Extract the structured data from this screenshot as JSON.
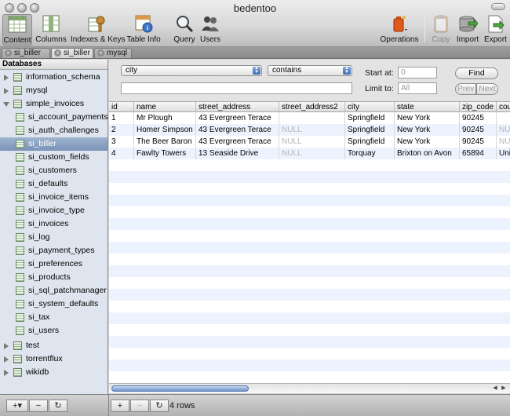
{
  "window": {
    "title": "bedentoo"
  },
  "toolbar": {
    "content": "Content",
    "columns": "Columns",
    "indexes": "Indexes & Keys",
    "table_info": "Table Info",
    "query": "Query",
    "users": "Users",
    "operations": "Operations",
    "copy": "Copy",
    "import": "Import",
    "export": "Export"
  },
  "tabs": [
    "si_biller",
    "si_biller",
    "mysql"
  ],
  "sidebar": {
    "header": "Databases",
    "items": [
      {
        "label": "information_schema"
      },
      {
        "label": "mysql"
      },
      {
        "label": "simple_invoices"
      },
      {
        "label": "si_account_payments"
      },
      {
        "label": "si_auth_challenges"
      },
      {
        "label": "si_biller"
      },
      {
        "label": "si_custom_fields"
      },
      {
        "label": "si_customers"
      },
      {
        "label": "si_defaults"
      },
      {
        "label": "si_invoice_items"
      },
      {
        "label": "si_invoice_type"
      },
      {
        "label": "si_invoices"
      },
      {
        "label": "si_log"
      },
      {
        "label": "si_payment_types"
      },
      {
        "label": "si_preferences"
      },
      {
        "label": "si_products"
      },
      {
        "label": "si_sql_patchmanager"
      },
      {
        "label": "si_system_defaults"
      },
      {
        "label": "si_tax"
      },
      {
        "label": "si_users"
      },
      {
        "label": "test"
      },
      {
        "label": "torrentflux"
      },
      {
        "label": "wikidb"
      }
    ]
  },
  "filter": {
    "field": "city",
    "operator": "contains",
    "value": "",
    "start_label": "Start at:",
    "start_placeholder": "0",
    "limit_label": "Limit to:",
    "limit_placeholder": "All",
    "find": "Find",
    "prev": "Prev",
    "next": "Next"
  },
  "grid": {
    "columns": [
      "id",
      "name",
      "street_address",
      "street_address2",
      "city",
      "state",
      "zip_code",
      "cou"
    ],
    "rows": [
      [
        "1",
        "Mr Plough",
        "43 Evergreen Terace",
        "",
        "Springfield",
        "New York",
        "90245",
        ""
      ],
      [
        "2",
        "Homer Simpson",
        "43 Evergreen Terace",
        "NULL",
        "Springfield",
        "New York",
        "90245",
        "NUL"
      ],
      [
        "3",
        "The Beer Baron",
        "43 Evergreen Terace",
        "NULL",
        "Springfield",
        "New York",
        "90245",
        "NUL"
      ],
      [
        "4",
        "Fawlty Towers",
        "13 Seaside Drive",
        "NULL",
        "Torquay",
        "Brixton on Avon",
        "65894",
        "Unit"
      ]
    ]
  },
  "bottom": {
    "sidebar_add": "+▾",
    "sidebar_remove": "−",
    "sidebar_refresh": "↻",
    "add": "+",
    "remove": "−",
    "refresh": "↻",
    "row_count": "4 rows"
  }
}
